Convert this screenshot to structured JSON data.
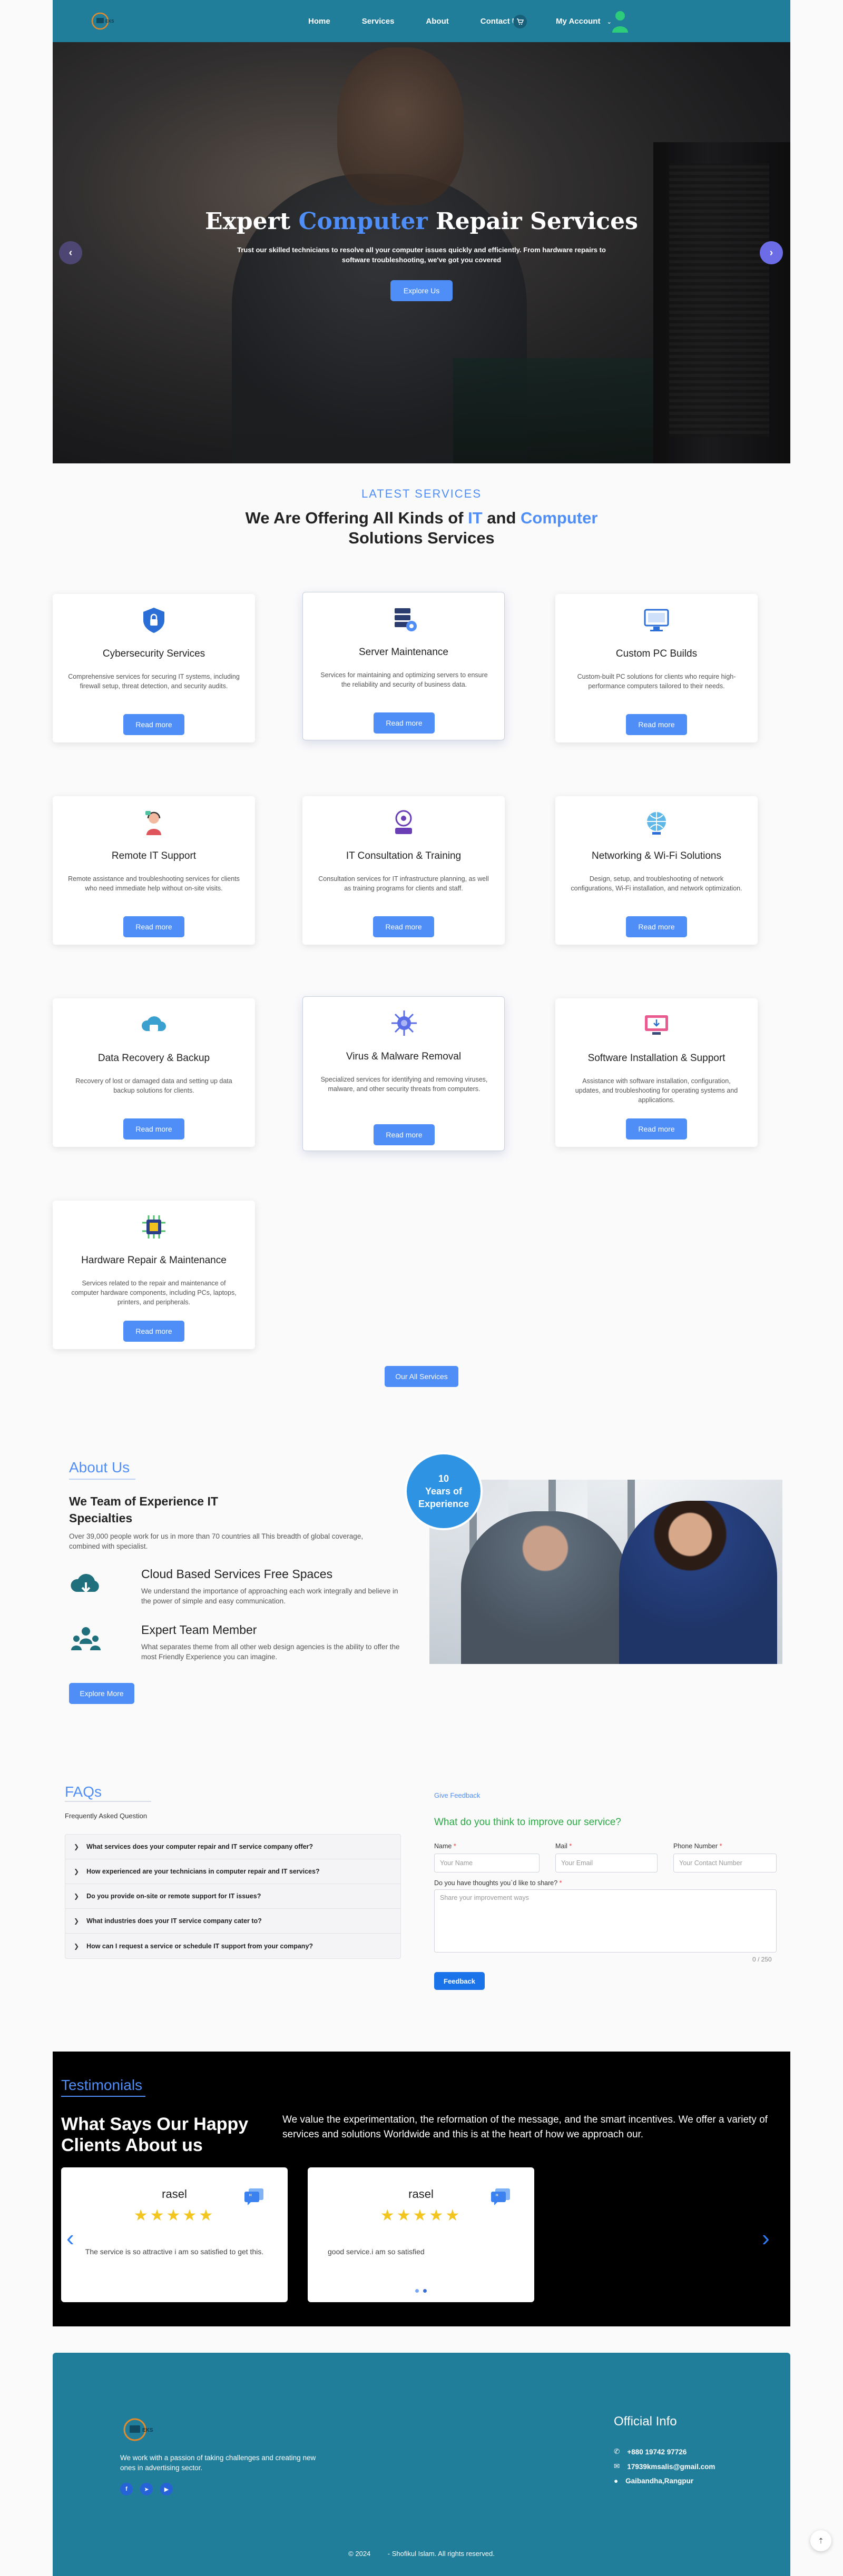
{
  "nav": {
    "links": [
      "Home",
      "Services",
      "About",
      "Contact Us"
    ],
    "account_label": "My Account",
    "colors": {
      "bar": "#217e9b",
      "accent": "#4f8ef7"
    }
  },
  "hero": {
    "title_part1": "Expert ",
    "title_highlight": "Computer",
    "title_part2": " Repair Services",
    "subtitle": "Trust our skilled technicians to resolve all your computer issues quickly and efficiently. From hardware repairs to software troubleshooting, we've got you covered",
    "button": "Explore Us"
  },
  "services": {
    "kicker": "LATEST SERVICES",
    "title_a": "We Are Offering All Kinds of ",
    "title_hl1": "IT",
    "title_b": " and ",
    "title_hl2": "Computer",
    "title_c": "Solutions Services",
    "read_more": "Read more",
    "items": [
      {
        "title": "Cybersecurity Services",
        "desc": "Comprehensive services for securing IT systems, including firewall setup, threat detection, and security audits.",
        "icon": "shield-lock-icon"
      },
      {
        "title": "Server Maintenance",
        "desc": "Services for maintaining and optimizing servers to ensure the reliability and security of business data.",
        "icon": "server-gear-icon"
      },
      {
        "title": "Custom PC Builds",
        "desc": "Custom-built PC solutions for clients who require high-performance computers tailored to their needs.",
        "icon": "pc-monitor-icon"
      },
      {
        "title": "Remote IT Support",
        "desc": "Remote assistance and troubleshooting services for clients who need immediate help without on-site visits.",
        "icon": "support-agent-icon"
      },
      {
        "title": "IT Consultation & Training",
        "desc": "Consultation services for IT infrastructure planning, as well as training programs for clients and staff.",
        "icon": "consultation-icon"
      },
      {
        "title": "Networking & Wi-Fi Solutions",
        "desc": "Design, setup, and troubleshooting of network configurations, Wi-Fi installation, and network optimization.",
        "icon": "network-globe-icon"
      },
      {
        "title": "Data Recovery & Backup",
        "desc": "Recovery of lost or damaged data and setting up data backup solutions for clients.",
        "icon": "cloud-backup-icon"
      },
      {
        "title": "Virus & Malware Removal",
        "desc": "Specialized services for identifying and removing viruses, malware, and other security threats from computers.",
        "icon": "virus-icon"
      },
      {
        "title": "Software Installation & Support",
        "desc": "Assistance with software installation, configuration, updates, and troubleshooting for operating systems and applications.",
        "icon": "software-install-icon"
      },
      {
        "title": "Hardware Repair & Maintenance",
        "desc": "Services related to the repair and maintenance of computer hardware components, including PCs, laptops, printers, and peripherals.",
        "icon": "chip-icon"
      }
    ],
    "all_button": "Our All Services"
  },
  "about": {
    "kicker": "About Us",
    "heading": "We Team of Experience IT Specialties",
    "paragraph": "Over 39,000 people work for us in more than 70 countries all This breadth of global coverage, combined with specialist.",
    "features": [
      {
        "title": "Cloud Based Services Free Spaces",
        "desc": "We understand the importance of approaching each work integrally and believe in the power of simple and easy communication.",
        "icon": "cloud-download-icon"
      },
      {
        "title": "Expert Team Member",
        "desc": "What separates theme from all other web design agencies is the ability to offer the most Friendly Experience you can imagine.",
        "icon": "team-icon"
      }
    ],
    "button": "Explore More",
    "badge_number": "10",
    "badge_line1": "Years of",
    "badge_line2": "Experience"
  },
  "faq": {
    "title": "FAQs",
    "subtitle": "Frequently Asked Question",
    "questions": [
      "What services does your computer repair and IT service company offer?",
      "How experienced are your technicians in computer repair and IT services?",
      "Do you provide on-site or remote support for IT issues?",
      "What industries does your IT service company cater to?",
      "How can I request a service or schedule IT support from your company?"
    ]
  },
  "feedback": {
    "kicker": "Give Feedback",
    "title": "What do you think to improve our service?",
    "name_label": "Name",
    "name_placeholder": "Your Name",
    "mail_label": "Mail",
    "mail_placeholder": "Your Email",
    "phone_label": "Phone Number",
    "phone_placeholder": "Your Contact Number",
    "thoughts_label": "Do you have thoughts you`d like to share?",
    "thoughts_placeholder": "Share your improvement ways",
    "counter": "0 / 250",
    "submit": "Feedback"
  },
  "testimonials": {
    "kicker": "Testimonials",
    "title": "What Says Our Happy Clients About us",
    "text": "We value the experimentation, the reformation of the message, and the smart incentives. We offer a variety of services and solutions Worldwide and this is at the heart of how we approach our.",
    "reviews": [
      {
        "name": "rasel",
        "stars": "★★★★★",
        "text": "The service is so attractive i am so satisfied to get this."
      },
      {
        "name": "rasel",
        "stars": "★★★★★",
        "text": "good service.i am so satisfied"
      }
    ]
  },
  "footer": {
    "description": "We work with a passion of taking challenges and creating new ones in advertising sector.",
    "info_title": "Official Info",
    "phone": "+880 19742 97726",
    "email": "17939kmsalis@gmail.com",
    "address": "Gaibandha,Rangpur",
    "copyright": "© 2024         - Shofikul Islam. All rights reserved."
  }
}
